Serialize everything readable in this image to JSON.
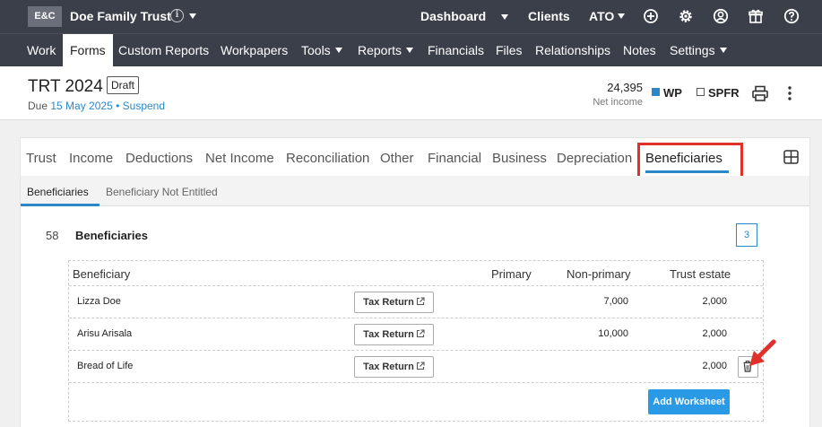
{
  "topbar": {
    "logo": "E&C",
    "entity_name": "Doe Family Trust",
    "info_glyph": "i",
    "links": {
      "dashboard": "Dashboard",
      "clients": "Clients",
      "ato": "ATO"
    },
    "icons": [
      "plus-circle-icon",
      "gear-icon",
      "user-circle-icon",
      "gift-icon",
      "help-icon"
    ]
  },
  "nav": {
    "items": [
      "Work",
      "Forms",
      "Custom Reports",
      "Workpapers",
      "Tools",
      "Reports",
      "Financials",
      "Files",
      "Relationships",
      "Notes",
      "Settings"
    ],
    "active": "Forms"
  },
  "header": {
    "title": "TRT 2024",
    "status_badge": "Draft",
    "due_prefix": "Due",
    "due_date": "15 May 2025",
    "separator": "•",
    "suspend": "Suspend",
    "net_income_value": "24,395",
    "net_income_label": "Net income",
    "wp_label": "WP",
    "spfr_label": "SPFR"
  },
  "tabs": {
    "items": [
      "Trust",
      "Income",
      "Deductions",
      "Net Income",
      "Reconciliation",
      "Other",
      "Financial",
      "Business",
      "Depreciation",
      "Beneficiaries"
    ],
    "active": "Beneficiaries"
  },
  "subtabs": {
    "items": [
      "Beneficiaries",
      "Beneficiary Not Entitled"
    ],
    "active": "Beneficiaries"
  },
  "section": {
    "number": "58",
    "title": "Beneficiaries",
    "count": "3"
  },
  "table": {
    "columns": [
      "Beneficiary",
      "Primary",
      "Non-primary",
      "Trust estate"
    ],
    "rows": [
      {
        "name": "Lizza Doe",
        "button": "Tax Return",
        "primary": "",
        "non_primary": "7,000",
        "trust_estate": "2,000"
      },
      {
        "name": "Arisu Arisala",
        "button": "Tax Return",
        "primary": "",
        "non_primary": "10,000",
        "trust_estate": "2,000"
      },
      {
        "name": "Bread of Life",
        "button": "Tax Return",
        "primary": "",
        "non_primary": "",
        "trust_estate": "2,000"
      }
    ],
    "add_button": "Add Worksheet"
  },
  "colors": {
    "topbar_bg": "#3b3f4a",
    "accent": "#2b88c8",
    "button_blue": "#2b9ae6",
    "annotation_red": "#e0302a"
  }
}
